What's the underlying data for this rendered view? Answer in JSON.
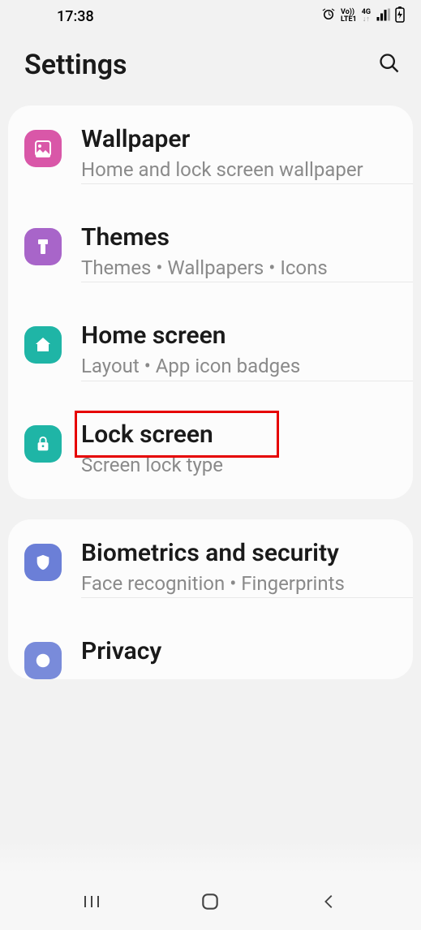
{
  "status": {
    "time": "17:38",
    "volte": "Vo))",
    "lte": "LTE1",
    "network": "4G"
  },
  "header": {
    "title": "Settings"
  },
  "groups": [
    {
      "items": [
        {
          "title": "Wallpaper",
          "subtitle": "Home and lock screen wallpaper",
          "icon": "image",
          "color": "pink"
        },
        {
          "title": "Themes",
          "subtitle": "Themes  •  Wallpapers  •  Icons",
          "icon": "brush",
          "color": "purple"
        },
        {
          "title": "Home screen",
          "subtitle": "Layout  •  App icon badges",
          "icon": "home",
          "color": "teal"
        },
        {
          "title": "Lock screen",
          "subtitle": "Screen lock type",
          "icon": "lock",
          "color": "teal",
          "highlighted": true
        }
      ]
    },
    {
      "items": [
        {
          "title": "Biometrics and security",
          "subtitle": "Face recognition  •  Fingerprints",
          "icon": "shield",
          "color": "blue"
        },
        {
          "title": "Privacy",
          "subtitle": "",
          "icon": "circle",
          "color": "blue"
        }
      ]
    }
  ]
}
